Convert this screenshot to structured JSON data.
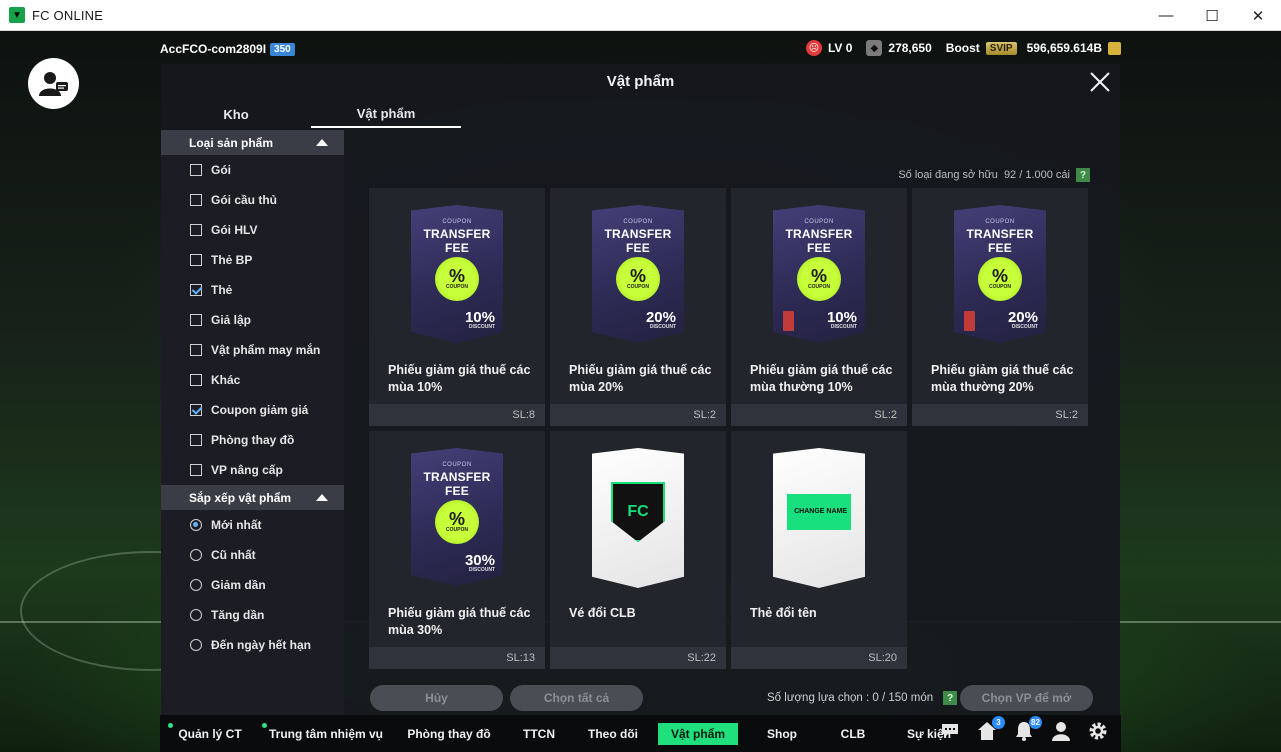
{
  "window": {
    "title": "FC ONLINE",
    "controls": [
      "—",
      "☐",
      "✕"
    ]
  },
  "hud": {
    "account": "AccFCO-com2809I",
    "level_badge": "350",
    "lv": "LV 0",
    "points": "278,650",
    "boost_label": "Boost",
    "svip": "SVIP",
    "bp": "596,659.614B"
  },
  "modal": {
    "title": "Vật phẩm",
    "tabs": [
      "Kho",
      "Vật phẩm"
    ],
    "owned_label": "Số loại đang sở hữu",
    "owned_value": "92 / 1.000 cái",
    "help": "?"
  },
  "filters": {
    "category_title": "Loại sản phẩm",
    "categories": [
      {
        "label": "Gói",
        "checked": false
      },
      {
        "label": "Gói cầu thủ",
        "checked": false
      },
      {
        "label": "Gói HLV",
        "checked": false
      },
      {
        "label": "Thẻ BP",
        "checked": false
      },
      {
        "label": "Thẻ",
        "checked": true
      },
      {
        "label": "Giả lập",
        "checked": false
      },
      {
        "label": "Vật phẩm may mắn",
        "checked": false
      },
      {
        "label": "Khác",
        "checked": false
      },
      {
        "label": "Coupon giảm giá",
        "checked": true
      },
      {
        "label": "Phòng thay đồ",
        "checked": false
      },
      {
        "label": "VP nâng cấp",
        "checked": false
      }
    ],
    "sort_title": "Sắp xếp vật phẩm",
    "sorts": [
      {
        "label": "Mới nhất",
        "checked": true
      },
      {
        "label": "Cũ nhất",
        "checked": false
      },
      {
        "label": "Giảm dần",
        "checked": false
      },
      {
        "label": "Tăng dần",
        "checked": false
      },
      {
        "label": "Đến ngày hết hạn",
        "checked": false
      }
    ]
  },
  "items": [
    {
      "name": "Phiếu giảm giá thuế các mùa 10%",
      "qty": "SL:8",
      "art": "coupon",
      "small": "COUPON",
      "big": "TRANSFER FEE",
      "seal": "%",
      "seal_sub": "COUPON",
      "pct": "10%",
      "pct_sub": "DISCOUNT",
      "ban": false
    },
    {
      "name": "Phiếu giảm giá thuế các mùa 20%",
      "qty": "SL:2",
      "art": "coupon",
      "small": "COUPON",
      "big": "TRANSFER FEE",
      "seal": "%",
      "seal_sub": "COUPON",
      "pct": "20%",
      "pct_sub": "DISCOUNT",
      "ban": false
    },
    {
      "name": "Phiếu giảm giá thuế các mùa thường 10%",
      "qty": "SL:2",
      "art": "coupon",
      "small": "COUPON",
      "big": "TRANSFER FEE",
      "seal": "%",
      "seal_sub": "COUPON",
      "pct": "10%",
      "pct_sub": "DISCOUNT",
      "ban": true
    },
    {
      "name": "Phiếu giảm giá thuế các mùa thường 20%",
      "qty": "SL:2",
      "art": "coupon",
      "small": "COUPON",
      "big": "TRANSFER FEE",
      "seal": "%",
      "seal_sub": "COUPON",
      "pct": "20%",
      "pct_sub": "DISCOUNT",
      "ban": true
    },
    {
      "name": "Phiếu giảm giá thuế các mùa 30%",
      "qty": "SL:13",
      "art": "coupon",
      "small": "COUPON",
      "big": "TRANSFER FEE",
      "seal": "%",
      "seal_sub": "COUPON",
      "pct": "30%",
      "pct_sub": "DISCOUNT",
      "ban": false
    },
    {
      "name": "Vé đổi CLB",
      "qty": "SL:22",
      "art": "club",
      "emblem": "FC"
    },
    {
      "name": "Thẻ đổi tên",
      "qty": "SL:20",
      "art": "rename",
      "ticket": "CHANGE NAME"
    }
  ],
  "actions": {
    "cancel": "Hủy",
    "select_all": "Chọn tất cả",
    "selection_label": "Số lượng lựa chọn : 0 / 150 món",
    "open": "Chọn VP để mở"
  },
  "bottom_nav": {
    "items": [
      {
        "label": "Quản lý CT",
        "dot": true,
        "active": false
      },
      {
        "label": "Trung tâm nhiệm vụ",
        "dot": true,
        "active": false
      },
      {
        "label": "Phòng thay đồ",
        "dot": false,
        "active": false
      },
      {
        "label": "TTCN",
        "dot": false,
        "active": false
      },
      {
        "label": "Theo dõi",
        "dot": false,
        "active": false
      },
      {
        "label": "Vật phẩm",
        "dot": false,
        "active": true
      },
      {
        "label": "Shop",
        "dot": false,
        "active": false
      },
      {
        "label": "CLB",
        "dot": false,
        "active": false
      },
      {
        "label": "Sự kiện",
        "dot": false,
        "active": false
      }
    ],
    "icons": [
      {
        "name": "chat-icon",
        "badge": ""
      },
      {
        "name": "home-icon",
        "badge": "3"
      },
      {
        "name": "bell-icon",
        "badge": "82"
      },
      {
        "name": "profile-icon",
        "badge": ""
      },
      {
        "name": "settings-icon",
        "badge": ""
      }
    ]
  },
  "colors": {
    "accent": "#20e07d",
    "check": "#5fb3ff",
    "panel": "#16181e"
  }
}
